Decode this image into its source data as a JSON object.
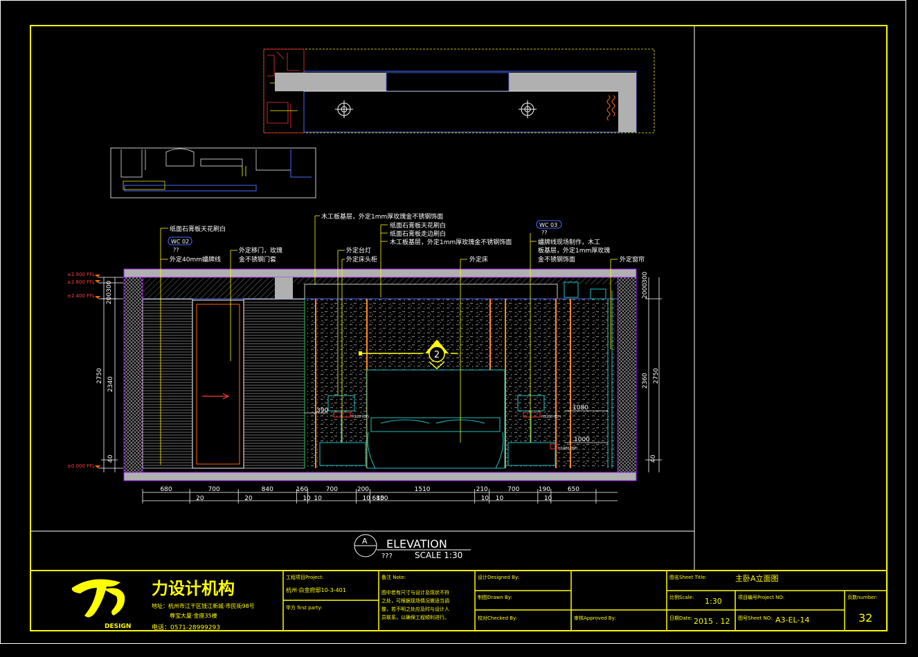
{
  "drawing": {
    "elevation_letter": "A",
    "elevation_word": "ELEVATION",
    "elevation_sub": "???",
    "scale_text": "SCALE  1:30"
  },
  "levels": {
    "lvl1": "±2.900 FFL",
    "lvl2": "±2.800 FFL",
    "lvl3": "±2.400 FFL",
    "lvl4": "±0.000 FFL"
  },
  "callouts": {
    "c1": "纸面石膏板天花刷白",
    "c2_tag": "WC  02",
    "c2_sub": "??",
    "c3": "外定40mm蟠牌线",
    "c4a": "外定移门，玫瑰",
    "c4b": "金不锈钢门套",
    "c5": "木工板基层，外定1mm厚玫瑰金不锈钢饰面",
    "c6": "外定台灯",
    "c7": "外定床头柜",
    "c8": "纸面石膏板天花刷白",
    "c9": "纸面石膏板走边刷白",
    "c10": "木工板基层，外定1mm厚玫瑰金不锈钢饰面",
    "c11": "外定床",
    "c12_tag": "WC  03",
    "c12_sub": "??",
    "c13a": "蟠牌线现场制作，木工",
    "c13b": "板基层，外定1mm厚玫瑰",
    "c13c": "金不锈钢饰面",
    "c14": "外定窗帘",
    "section_mark": "2",
    "sock1": "H120 (EP)",
    "sock2": "H1200 (EP)",
    "sock3": "H1000 (EP)"
  },
  "dims": {
    "left": [
      "300",
      "2750",
      "2340",
      "40"
    ],
    "left_b": "200",
    "right": [
      "2000",
      "2360",
      "2750",
      "40"
    ],
    "right_b": "300",
    "inner": [
      "390",
      "1080",
      "1000"
    ],
    "bottom": [
      "680",
      "700",
      "840",
      "160",
      "700",
      "200",
      "1510",
      "210",
      "700",
      "190",
      "650"
    ],
    "bottom2": [
      "20",
      "20",
      "10",
      "10",
      "10",
      "10",
      "10",
      "10",
      "10"
    ],
    "total": "6850"
  },
  "title_block": {
    "logo_text": "DESIGN",
    "company": "力设计机构",
    "address1": "地址：杭州市江干区钱江新城·市民街98号",
    "address2": "尊宝大厦·金座35楼",
    "phone": "电话：0571-28999293",
    "project_label": "工程项目Project:",
    "project_value": "杭州·白金府邸10-3-401",
    "party_label": "甲方  first party:",
    "notes_label": "备注 Note:",
    "notes_lines": [
      "图中若有尺寸与设计及现状不符",
      "之处，可根据现场情况做适当调",
      "整，若不明之处应及时与设计人",
      "员联系，以确保工程顺利进行。"
    ],
    "designed_label": "设计Designed By:",
    "drawn_label": "制图Drawn By:",
    "checked_label": "校对Checked By:",
    "approved_label": "审核Approved By:",
    "sheet_title_label": "图名Sheet Title:",
    "sheet_title_value": "主卧A立面图",
    "scale_label": "比例Scale:",
    "scale_value": "1:30",
    "projno_label": "项目编号Project NO:",
    "pagenum_label": "页数number:",
    "date_label": "日期Date:",
    "date_value": "2015 . 12",
    "sheetno_label": "图号Sheet NO:",
    "sheetno_value": "A3-EL-14",
    "page_value": "32"
  }
}
